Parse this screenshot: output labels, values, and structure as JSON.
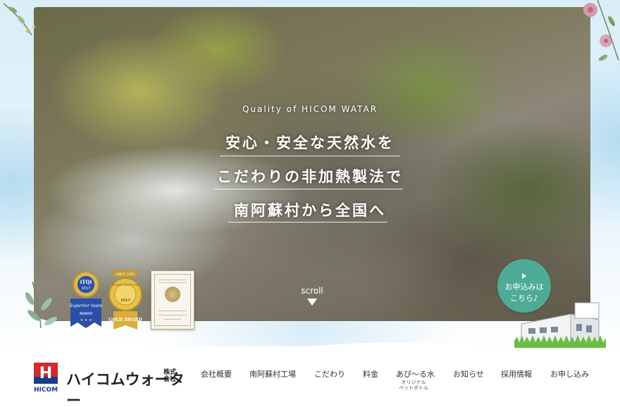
{
  "hero": {
    "tagline": "Quality of HICOM WATAR",
    "headline": [
      "安心・安全な天然水を",
      "こだわりの非加熱製法で",
      "南阿蘇村から全国へ"
    ],
    "scroll_label": "scroll"
  },
  "awards": {
    "blue": {
      "top": "iTQi",
      "year": "2017",
      "mid": "Superior taste",
      "bottom": "AWARD"
    },
    "gold": {
      "top": "SINCE 1961",
      "ring": "MONDE SELECTION",
      "year": "2017",
      "bottom": "GOLD AWARD"
    }
  },
  "apply_button": {
    "line1": "お申込みは",
    "line2": "こちら♪"
  },
  "logo": {
    "mark_letter": "H",
    "sub": "HICOM",
    "name": "ハイコムウォーター",
    "suffix": "株式会社"
  },
  "nav": {
    "items": [
      {
        "label": "会社概要"
      },
      {
        "label": "南阿蘇村工場"
      },
      {
        "label": "こだわり"
      },
      {
        "label": "料金"
      },
      {
        "label": "あぴ〜る水",
        "sub": "オリジナル\nペットボトル"
      },
      {
        "label": "お知らせ"
      },
      {
        "label": "採用情報"
      },
      {
        "label": "お申し込み"
      }
    ]
  },
  "colors": {
    "accent_green": "#4eab95",
    "logo_red": "#d42a2a",
    "logo_blue": "#1a3a8a",
    "text_dark": "#333333"
  }
}
